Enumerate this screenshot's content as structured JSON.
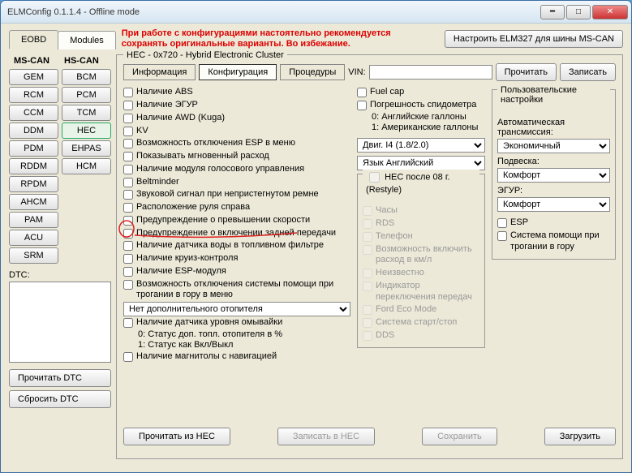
{
  "window": {
    "title": "ELMConfig 0.1.1.4 - Offline mode"
  },
  "tabs": {
    "eobd": "EOBD",
    "modules": "Modules"
  },
  "warning": "При работе с конфигурациями настоятельно рекомендуется сохранять оригинальные варианты. Во избежание.",
  "elm_btn": "Настроить ELM327 для шины MS-CAN",
  "canheads": {
    "ms": "MS-CAN",
    "hs": "HS-CAN"
  },
  "mods_ms": [
    "GEM",
    "RCM",
    "CCM",
    "DDM",
    "PDM",
    "RDDM",
    "RPDM",
    "AHCM",
    "PAM",
    "ACU",
    "SRM"
  ],
  "mods_hs": [
    "BCM",
    "PCM",
    "TCM",
    "HEC",
    "EHPAS",
    "HCM"
  ],
  "dtc_label": "DTC:",
  "leftbtns": {
    "read": "Прочитать DTC",
    "clear": "Сбросить DTC"
  },
  "group": "HEC - 0x720 - Hybrid Electronic Cluster",
  "subtabs": {
    "info": "Информация",
    "cfg": "Конфигурация",
    "proc": "Процедуры"
  },
  "vin": {
    "label": "VIN:",
    "value": ""
  },
  "topbtns": {
    "read": "Прочитать",
    "write": "Записать"
  },
  "checks1": [
    "Наличие ABS",
    "Наличие ЭГУР",
    "Наличие AWD (Kuga)",
    "KV",
    "Возможность отключения ESP в меню",
    "Показывать мгновенный расход",
    "Наличие модуля голосового управления",
    "Beltminder",
    "Звуковой сигнал при непристегнутом ремне",
    "Расположение руля справа",
    "Предупреждение о превышении скорости",
    "Предупреждение о включении задней передачи",
    "Наличие датчика воды в топливном фильтре",
    "Наличие круиз-контроля",
    "Наличие ESP-модуля",
    "Возможность отключения системы помощи при трогании в гору в меню"
  ],
  "heater_sel": "Нет дополнительного отопителя",
  "checks1b": [
    "Наличие датчика уровня омывайки"
  ],
  "info_stat": [
    "0: Статус доп. топл. отопителя в %",
    "1: Статус как Вкл/Выкл"
  ],
  "checks1c": [
    "Наличие магнитолы с навигацией"
  ],
  "checks2a": [
    "Fuel cap",
    "Погрешность спидометра"
  ],
  "info_gal": [
    "0: Английские галлоны",
    "1: Американские галлоны"
  ],
  "engine_sel": "Двиг. I4 (1.8/2.0)",
  "lang_sel": "Язык Английский",
  "restyle_title": "HEC после 08 г. (Restyle)",
  "checks_restyle": [
    "Часы",
    "RDS",
    "Телефон",
    "Возможность включить расход в км/л",
    "Неизвестно",
    "Индикатор переключения передач",
    "Ford Eco Mode",
    "Система старт/стоп",
    "DDS"
  ],
  "usersettings": {
    "title": "Пользовательские настройки",
    "trans_lbl": "Автоматическая трансмиссия:",
    "trans_sel": "Экономичный",
    "susp_lbl": "Подвеска:",
    "susp_sel": "Комфорт",
    "egur_lbl": "ЭГУР:",
    "egur_sel": "Комфорт",
    "esp": "ESP",
    "hill": "Система помощи при трогании в гору"
  },
  "bottom": {
    "read": "Прочитать из HEC",
    "write": "Записать в HEC",
    "save": "Сохранить",
    "load": "Загрузить"
  }
}
